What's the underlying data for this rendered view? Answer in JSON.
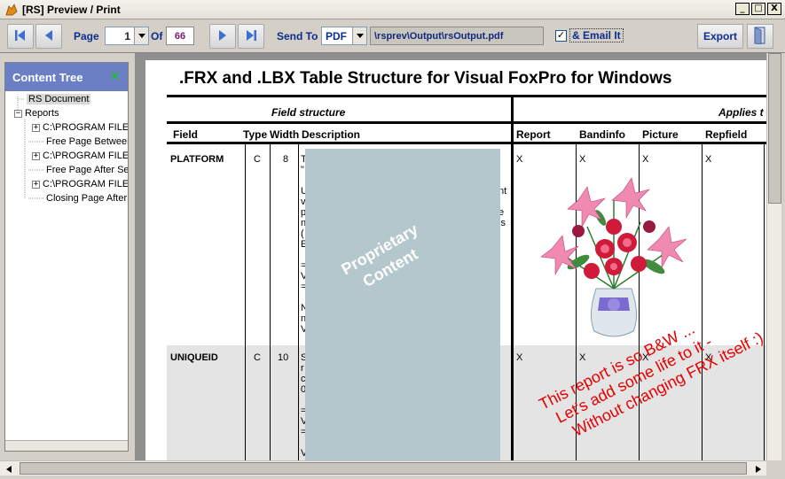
{
  "window": {
    "title": "[RS] Preview  / Print",
    "buttons": [
      "_",
      "□",
      "X"
    ]
  },
  "toolbar": {
    "page_label": "Page",
    "page_value": "1",
    "of_label": "Of",
    "total_pages": "66",
    "sendto_label": "Send To",
    "format_value": "PDF",
    "output_path": "\\rsprev\\Output\\rsOutput.pdf",
    "email_checked": "✓",
    "email_label": "& Email It",
    "export_label": "Export"
  },
  "tree": {
    "header": "Content Tree",
    "close": "✕",
    "items": [
      {
        "label": "RS Document",
        "expander": ""
      },
      {
        "label": "Reports",
        "expander": "−"
      },
      {
        "label": "C:\\PROGRAM FILES",
        "expander": "+"
      },
      {
        "label": "Free Page Between",
        "expander": ""
      },
      {
        "label": "C:\\PROGRAM FILES",
        "expander": "+"
      },
      {
        "label": "Free Page After Se",
        "expander": ""
      },
      {
        "label": "C:\\PROGRAM FILES",
        "expander": "+"
      },
      {
        "label": "Closing Page After",
        "expander": ""
      }
    ]
  },
  "report": {
    "title": ".FRX and .LBX Table Structure for Visual FoxPro for Windows",
    "section_field": "Field structure",
    "section_applies": "Applies t",
    "columns": [
      "Field",
      "Type",
      "Width",
      "Description",
      "Report",
      "Bandinfo",
      "Picture",
      "Repfield"
    ],
    "rows": [
      {
        "field": "PLATFORM",
        "type": "C",
        "width": "8",
        "marks": [
          "X",
          "X",
          "X",
          "X"
        ]
      },
      {
        "field": "UNIQUEID",
        "type": "C",
        "width": "10",
        "marks": [
          "X",
          "X",
          "X",
          "X"
        ]
      }
    ],
    "desc_fragments": [
      "T",
      "\"",
      "U",
      "v",
      "p",
      "n",
      "(",
      "E",
      "=",
      "V",
      "=",
      "N",
      "n",
      "V"
    ],
    "desc_fragments_right": [
      "nt",
      "e",
      "ls"
    ],
    "desc_fragments_row2": [
      "S",
      "r",
      "c",
      "0",
      "=",
      "V",
      "=",
      "V"
    ],
    "overlay_text": "Proprietary Content",
    "note_lines": [
      "This report is so B&W ...",
      "Let's add some life to it -",
      "Without changing FRX itself :)"
    ]
  },
  "colors": {
    "tree_header": "#6b7fc4",
    "overlay": "#b4c7cd",
    "note": "#e60000",
    "label_blue": "#0b2d8e"
  }
}
